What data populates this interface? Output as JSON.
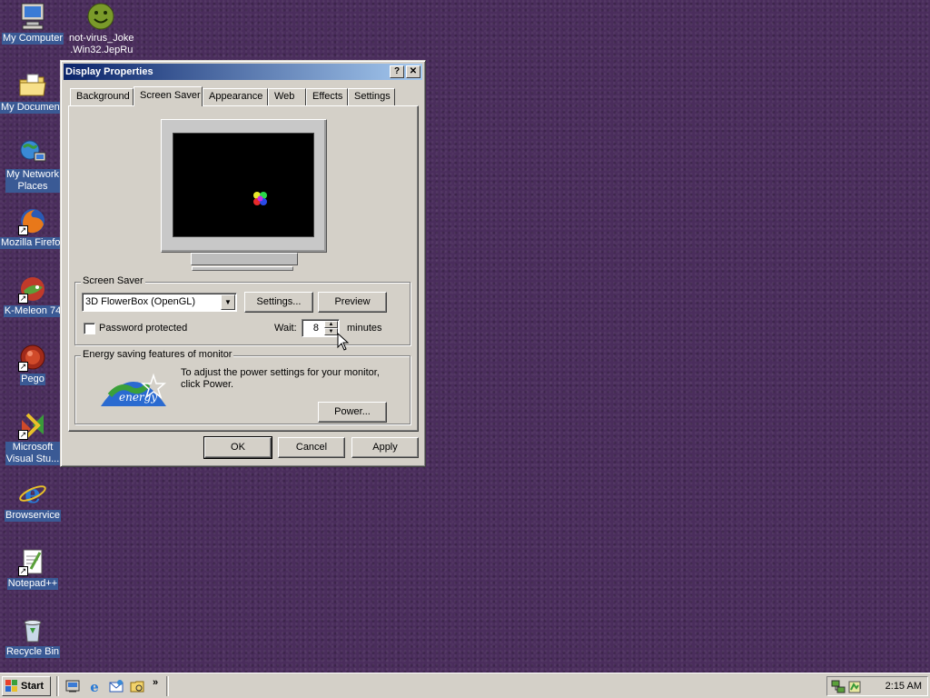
{
  "desktop": {
    "icons": [
      {
        "label": "My Computer",
        "icon": "my-computer-icon"
      },
      {
        "label": "not-virus_Joke\n.Win32.JepRu",
        "icon": "smiley-icon"
      },
      {
        "label": "My Documents",
        "icon": "folder-icon"
      },
      {
        "label": "My Network\nPlaces",
        "icon": "network-icon"
      },
      {
        "label": "Mozilla Firefox",
        "icon": "firefox-icon"
      },
      {
        "label": "K-Meleon 74",
        "icon": "kmeleon-icon"
      },
      {
        "label": "Pego",
        "icon": "pego-icon"
      },
      {
        "label": "Microsoft\nVisual Stu...",
        "icon": "visual-studio-icon"
      },
      {
        "label": "Browservice",
        "icon": "internet-explorer-icon"
      },
      {
        "label": "Notepad++",
        "icon": "notepadpp-icon"
      },
      {
        "label": "Recycle Bin",
        "icon": "recycle-bin-icon"
      }
    ]
  },
  "dialog": {
    "title": "Display Properties",
    "help_glyph": "?",
    "close_glyph": "✕",
    "tabs": [
      "Background",
      "Screen Saver",
      "Appearance",
      "Web",
      "Effects",
      "Settings"
    ],
    "active_tab": "Screen Saver",
    "screen_saver": {
      "group_title": "Screen Saver",
      "selected": "3D FlowerBox (OpenGL)",
      "settings_label": "Settings...",
      "preview_label": "Preview",
      "password_label": "Password protected",
      "password_checked": false,
      "wait_label": "Wait:",
      "wait_value": "8",
      "minutes_label": "minutes"
    },
    "energy": {
      "group_title": "Energy saving features of monitor",
      "description": "To adjust the power settings for your monitor, click Power.",
      "power_label": "Power..."
    },
    "buttons": {
      "ok": "OK",
      "cancel": "Cancel",
      "apply": "Apply"
    }
  },
  "taskbar": {
    "start_label": "Start",
    "quick_launch": [
      "show-desktop-icon",
      "internet-explorer-icon",
      "outlook-express-icon",
      "explorer-icon"
    ],
    "chevron": "»",
    "clock": "2:15 AM"
  },
  "colors": {
    "desktop": "#4a2d5c",
    "titlebar_start": "#0a246a",
    "titlebar_end": "#a6caf0",
    "face": "#d4d0c8"
  }
}
